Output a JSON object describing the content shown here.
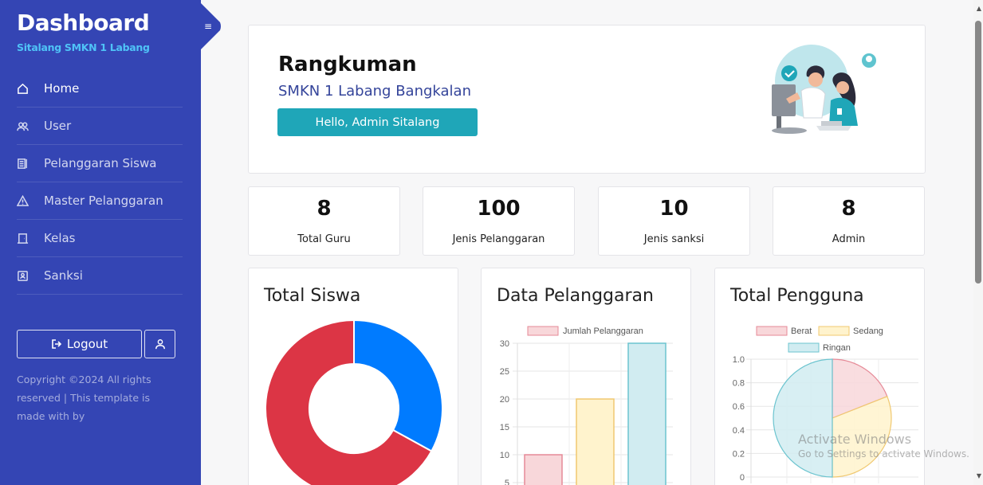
{
  "sidebar": {
    "title": "Dashboard",
    "subtitle": "Sitalang SMKN 1 Labang",
    "items": [
      {
        "label": "Home",
        "icon": "home-icon"
      },
      {
        "label": "User",
        "icon": "users-icon"
      },
      {
        "label": "Pelanggaran Siswa",
        "icon": "list-icon"
      },
      {
        "label": "Master Pelanggaran",
        "icon": "warning-icon"
      },
      {
        "label": "Kelas",
        "icon": "door-icon"
      },
      {
        "label": "Sanksi",
        "icon": "badge-icon"
      }
    ],
    "logout_label": "Logout",
    "copyright": "Copyright ©2024 All rights reserved | This template is made with by"
  },
  "hero": {
    "title": "Rangkuman",
    "subtitle": "SMKN 1 Labang Bangkalan",
    "button": "Hello, Admin Sitalang"
  },
  "stats": [
    {
      "value": "8",
      "label": "Total Guru"
    },
    {
      "value": "100",
      "label": "Jenis Pelanggaran"
    },
    {
      "value": "10",
      "label": "Jenis sanksi"
    },
    {
      "value": "8",
      "label": "Admin"
    }
  ],
  "chart_titles": {
    "siswa": "Total Siswa",
    "pelanggaran": "Data Pelanggaran",
    "pengguna": "Total Pengguna"
  },
  "chart_data": [
    {
      "type": "pie",
      "title": "Total Siswa",
      "values": [
        33,
        67
      ],
      "colors": [
        "#007bff",
        "#dc3545"
      ]
    },
    {
      "type": "bar",
      "title": "Data Pelanggaran",
      "legend": [
        "Jumlah Pelanggaran"
      ],
      "values": [
        10,
        20,
        30
      ],
      "colors": [
        "#f8d7da",
        "#fff3cd",
        "#d1ecf1"
      ],
      "ylim": [
        0,
        30
      ],
      "yticks": [
        5,
        10,
        15,
        20,
        25,
        30
      ]
    },
    {
      "type": "pie",
      "title": "Total Pengguna",
      "legend": [
        "Berat",
        "Sedang",
        "Ringan"
      ],
      "values": [
        0.19,
        0.31,
        0.5
      ],
      "colors": [
        "#f8d7da",
        "#fff3cd",
        "#d1ecf1"
      ],
      "ylim": [
        0,
        1.0
      ],
      "yticks": [
        "0",
        "0.2",
        "0.4",
        "0.6",
        "0.8",
        "1.0"
      ]
    }
  ],
  "watermark": {
    "line1": "Activate Windows",
    "line2": "Go to Settings to activate Windows."
  }
}
